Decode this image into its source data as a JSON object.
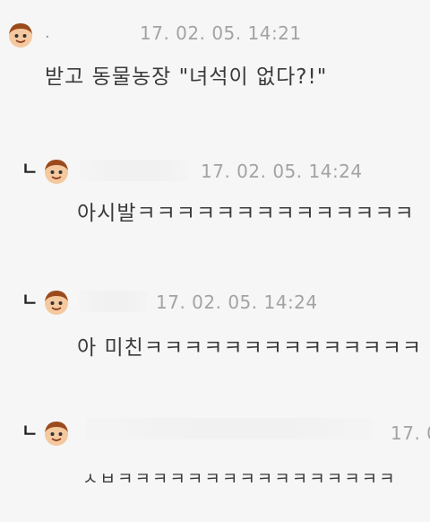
{
  "comments": [
    {
      "dot": ".",
      "timestamp": "17. 02. 05.  14:21",
      "text": "받고 동물농장 \"녀석이 없다?!\""
    },
    {
      "reply_marker": "ㄴ",
      "timestamp": "17. 02. 05.  14:24",
      "text": "아시발ㅋㅋㅋㅋㅋㅋㅋㅋㅋㅋㅋㅋㅋㅋ"
    },
    {
      "reply_marker": "ㄴ",
      "timestamp": "17. 02. 05.  14:24",
      "text": "아 미친ㅋㅋㅋㅋㅋㅋㅋㅋㅋㅋㅋㅋㅋㅋ"
    },
    {
      "reply_marker": "ㄴ",
      "timestamp": "17. 0",
      "text": "ㅅㅂㅋㅋㅋㅋㅋㅋㅋㅋㅋㅋㅋㅋㅋㅋㅋㅋ"
    }
  ],
  "icons": {
    "avatar": "cartoon-face-avatar-icon"
  }
}
